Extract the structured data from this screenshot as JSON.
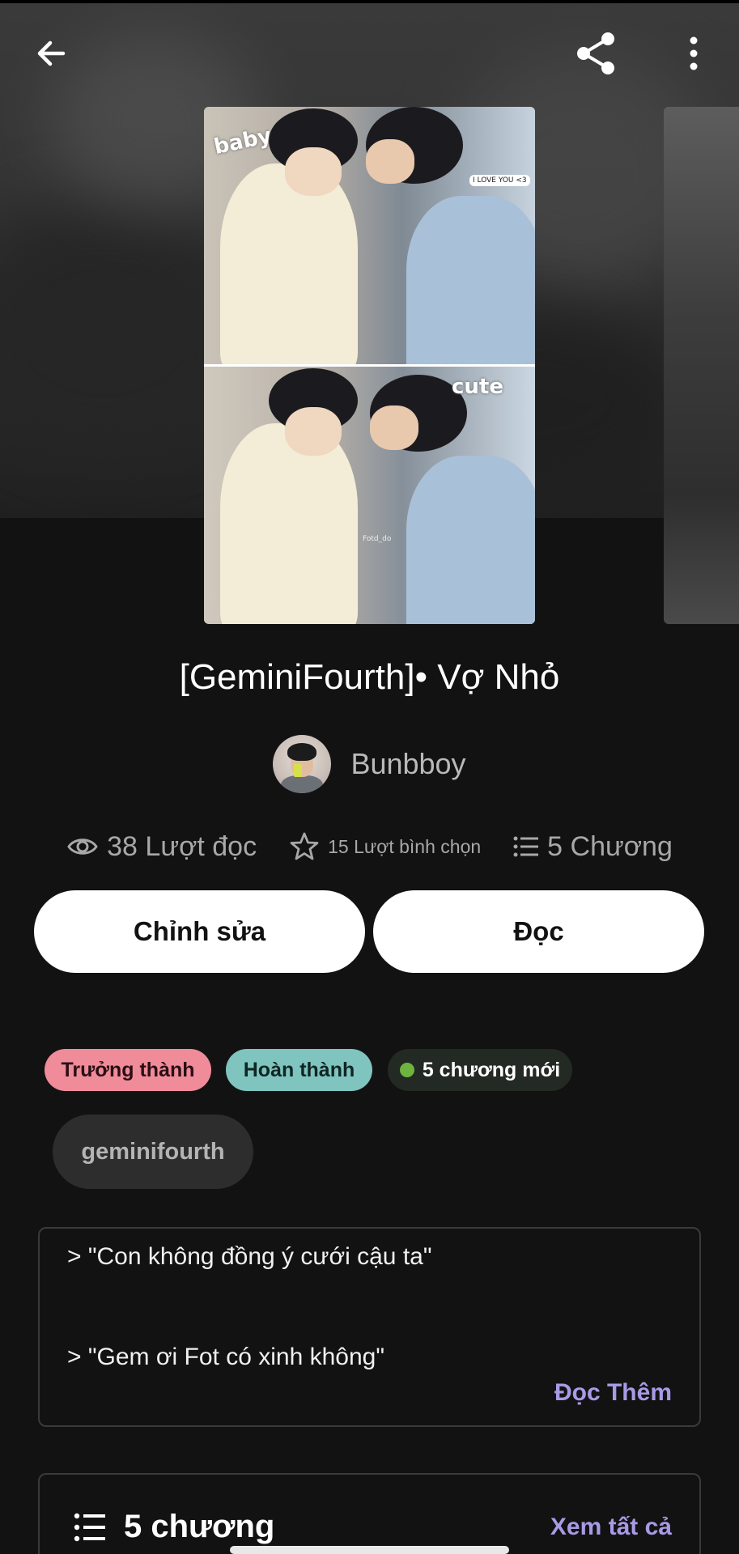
{
  "app_bar": {
    "back_icon": "arrow-left-icon",
    "share_icon": "share-icon",
    "more_icon": "more-vertical-icon"
  },
  "cover": {
    "stickers": [
      "baby",
      "cute"
    ],
    "bubble_text": "I LOVE YOU <3",
    "watermark": "Fotd_do"
  },
  "story": {
    "title": "[GeminiFourth]• Vợ Nhỏ",
    "author": "Bunbboy"
  },
  "stats": {
    "reads": "38 Lượt đọc",
    "votes": "15 Lượt bình chọn",
    "chapters": "5 Chương"
  },
  "actions": {
    "edit_label": "Chỉnh sửa",
    "read_label": "Đọc"
  },
  "tags": {
    "mature": "Trưởng thành",
    "complete": "Hoàn thành",
    "new_chapters": "5 chương mới",
    "keyword": "geminifourth"
  },
  "description": {
    "line1": "> \"Con không đồng ý cưới cậu ta\"",
    "line2": "> \"Gem ơi Fot có xinh không\"",
    "read_more": "Đọc Thêm"
  },
  "chapter_section": {
    "count_label": "5 chương",
    "see_all": "Xem tất cả"
  },
  "colors": {
    "background": "#121212",
    "accent": "#a99ae6",
    "tag_mature": "#f08b9a",
    "tag_complete": "#7fc4bf",
    "new_dot": "#6fb43f"
  }
}
